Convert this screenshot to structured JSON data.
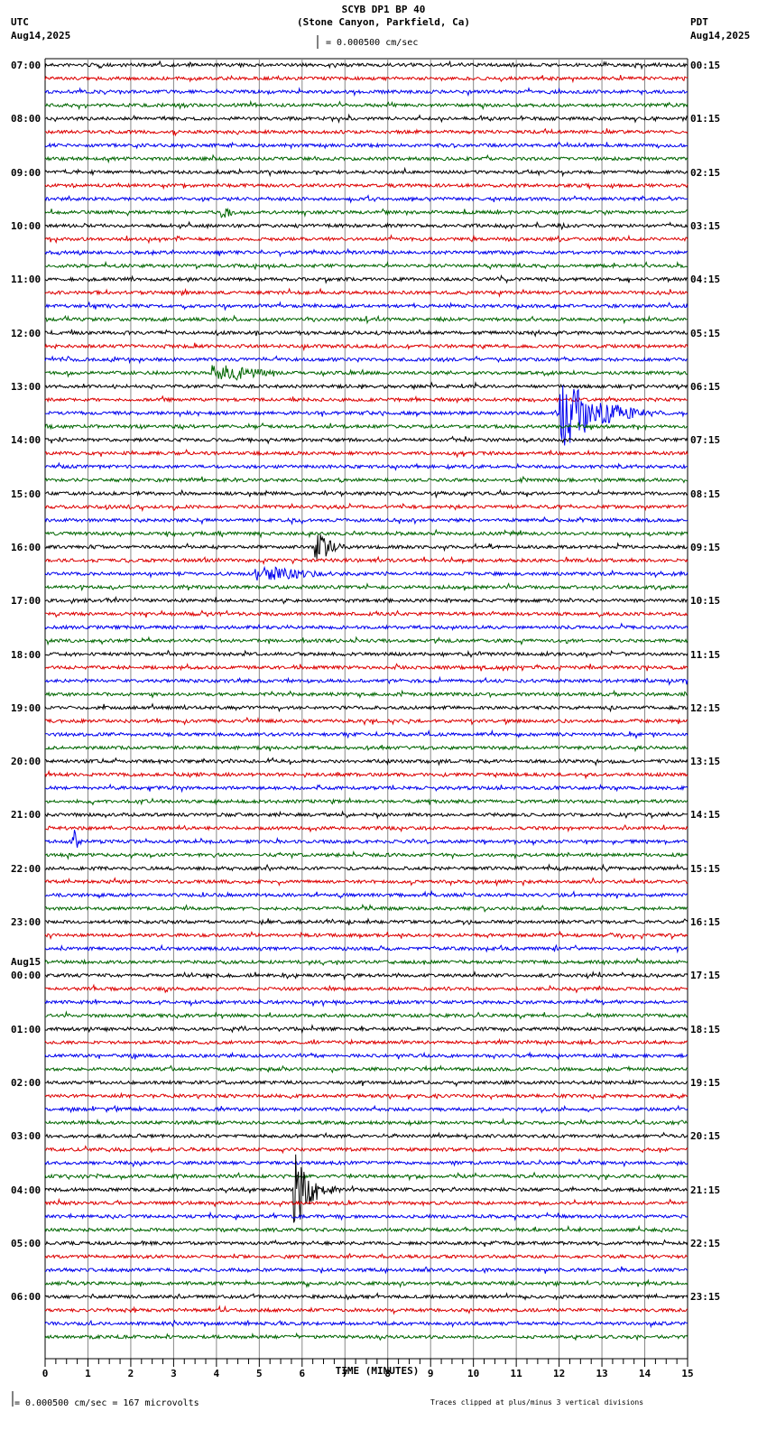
{
  "header": {
    "title": "SCYB DP1 BP 40",
    "subtitle": "(Stone Canyon, Parkfield, Ca)",
    "left_tz": "UTC",
    "left_date": "Aug14,2025",
    "right_tz": "PDT",
    "right_date": "Aug14,2025",
    "scale": "= 0.000500 cm/sec"
  },
  "footer": {
    "scale": "= 0.000500 cm/sec =     167 microvolts",
    "clip_note": "Traces clipped at plus/minus 3 vertical divisions"
  },
  "chart_data": {
    "type": "line",
    "title": "SCYB DP1 BP 40",
    "xlabel": "TIME (MINUTES)",
    "xlim": [
      0,
      15
    ],
    "xticks": [
      "0",
      "1",
      "2",
      "3",
      "4",
      "5",
      "6",
      "7",
      "8",
      "9",
      "10",
      "11",
      "12",
      "13",
      "14",
      "15"
    ],
    "traces_per_hour": 4,
    "trace_count": 96,
    "colors": [
      "#000000",
      "#dd0000",
      "#0000ee",
      "#006600"
    ],
    "left_labels": [
      {
        "trace": 0,
        "text": "07:00"
      },
      {
        "trace": 4,
        "text": "08:00"
      },
      {
        "trace": 8,
        "text": "09:00"
      },
      {
        "trace": 12,
        "text": "10:00"
      },
      {
        "trace": 16,
        "text": "11:00"
      },
      {
        "trace": 20,
        "text": "12:00"
      },
      {
        "trace": 24,
        "text": "13:00"
      },
      {
        "trace": 28,
        "text": "14:00"
      },
      {
        "trace": 32,
        "text": "15:00"
      },
      {
        "trace": 36,
        "text": "16:00"
      },
      {
        "trace": 40,
        "text": "17:00"
      },
      {
        "trace": 44,
        "text": "18:00"
      },
      {
        "trace": 48,
        "text": "19:00"
      },
      {
        "trace": 52,
        "text": "20:00"
      },
      {
        "trace": 56,
        "text": "21:00"
      },
      {
        "trace": 60,
        "text": "22:00"
      },
      {
        "trace": 64,
        "text": "23:00"
      },
      {
        "trace": 68,
        "text": "00:00",
        "date": "Aug15"
      },
      {
        "trace": 72,
        "text": "01:00"
      },
      {
        "trace": 76,
        "text": "02:00"
      },
      {
        "trace": 80,
        "text": "03:00"
      },
      {
        "trace": 84,
        "text": "04:00"
      },
      {
        "trace": 88,
        "text": "05:00"
      },
      {
        "trace": 92,
        "text": "06:00"
      }
    ],
    "right_labels": [
      "00:15",
      "01:15",
      "02:15",
      "03:15",
      "04:15",
      "05:15",
      "06:15",
      "07:15",
      "08:15",
      "09:15",
      "10:15",
      "11:15",
      "12:15",
      "13:15",
      "14:15",
      "15:15",
      "16:15",
      "17:15",
      "18:15",
      "19:15",
      "20:15",
      "21:15",
      "22:15",
      "23:15"
    ],
    "events": [
      {
        "trace": 11,
        "start": 4.1,
        "peak": 4.3,
        "end": 4.8,
        "amp": 0.4
      },
      {
        "trace": 23,
        "start": 3.9,
        "peak": 4.4,
        "end": 7.0,
        "amp": 0.6
      },
      {
        "trace": 26,
        "start": 12.0,
        "peak": 12.0,
        "end": 15.0,
        "amp": 3.0
      },
      {
        "trace": 27,
        "start": 0.0,
        "peak": 0.1,
        "end": 1.6,
        "amp": 0.2
      },
      {
        "trace": 32,
        "start": 6.5,
        "peak": 6.55,
        "end": 6.7,
        "amp": 0.3
      },
      {
        "trace": 36,
        "start": 6.3,
        "peak": 6.45,
        "end": 7.6,
        "amp": 1.0
      },
      {
        "trace": 38,
        "start": 4.9,
        "peak": 5.4,
        "end": 9.5,
        "amp": 0.5
      },
      {
        "trace": 40,
        "start": 1.4,
        "peak": 1.5,
        "end": 1.9,
        "amp": 0.2
      },
      {
        "trace": 58,
        "start": 0.6,
        "peak": 0.7,
        "end": 1.0,
        "amp": 0.9
      },
      {
        "trace": 84,
        "start": 5.8,
        "peak": 5.85,
        "end": 7.2,
        "amp": 3.0
      }
    ]
  }
}
